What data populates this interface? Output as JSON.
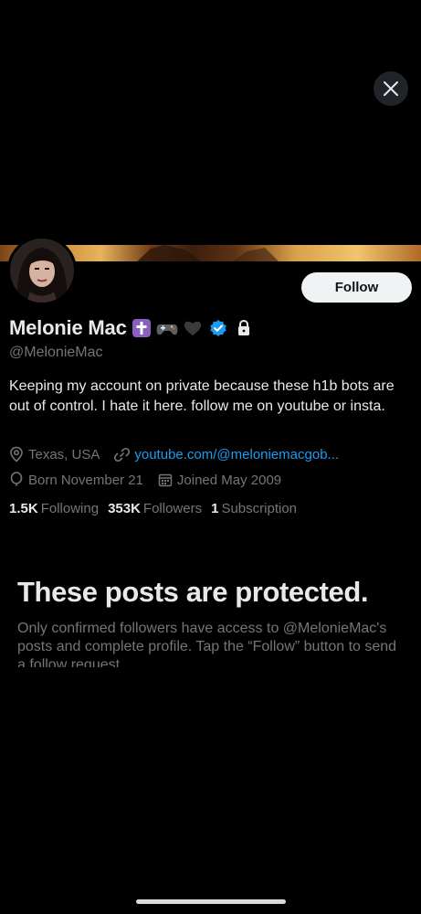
{
  "header": {
    "close_icon": "close-icon"
  },
  "profile": {
    "display_name": "Melonie Mac",
    "name_emojis": [
      "cross-emoji",
      "gamepad-emoji",
      "black-heart-emoji"
    ],
    "verified_icon": "verified-badge-icon",
    "protected_icon": "lock-icon",
    "handle": "@MelonieMac",
    "bio": "Keeping my account on private because these h1b bots are out of control. I hate it here. follow me on youtube or insta.",
    "location": "Texas, USA",
    "website": "youtube.com/@meloniemacgob...",
    "birthday": "Born November 21",
    "joined": "Joined May 2009",
    "follow_label": "Follow"
  },
  "stats": {
    "following_count": "1.5K",
    "following_label": "Following",
    "followers_count": "353K",
    "followers_label": "Followers",
    "subscriptions_count": "1",
    "subscriptions_label": "Subscription"
  },
  "protected_notice": {
    "title": "These posts are protected.",
    "body": "Only confirmed followers have access to @MelonieMac's posts and complete profile. Tap the “Follow” button to send a follow request."
  },
  "colors": {
    "accent": "#1d9bf0",
    "background": "#000000",
    "muted": "#71767b",
    "text": "#e7e9ea"
  }
}
